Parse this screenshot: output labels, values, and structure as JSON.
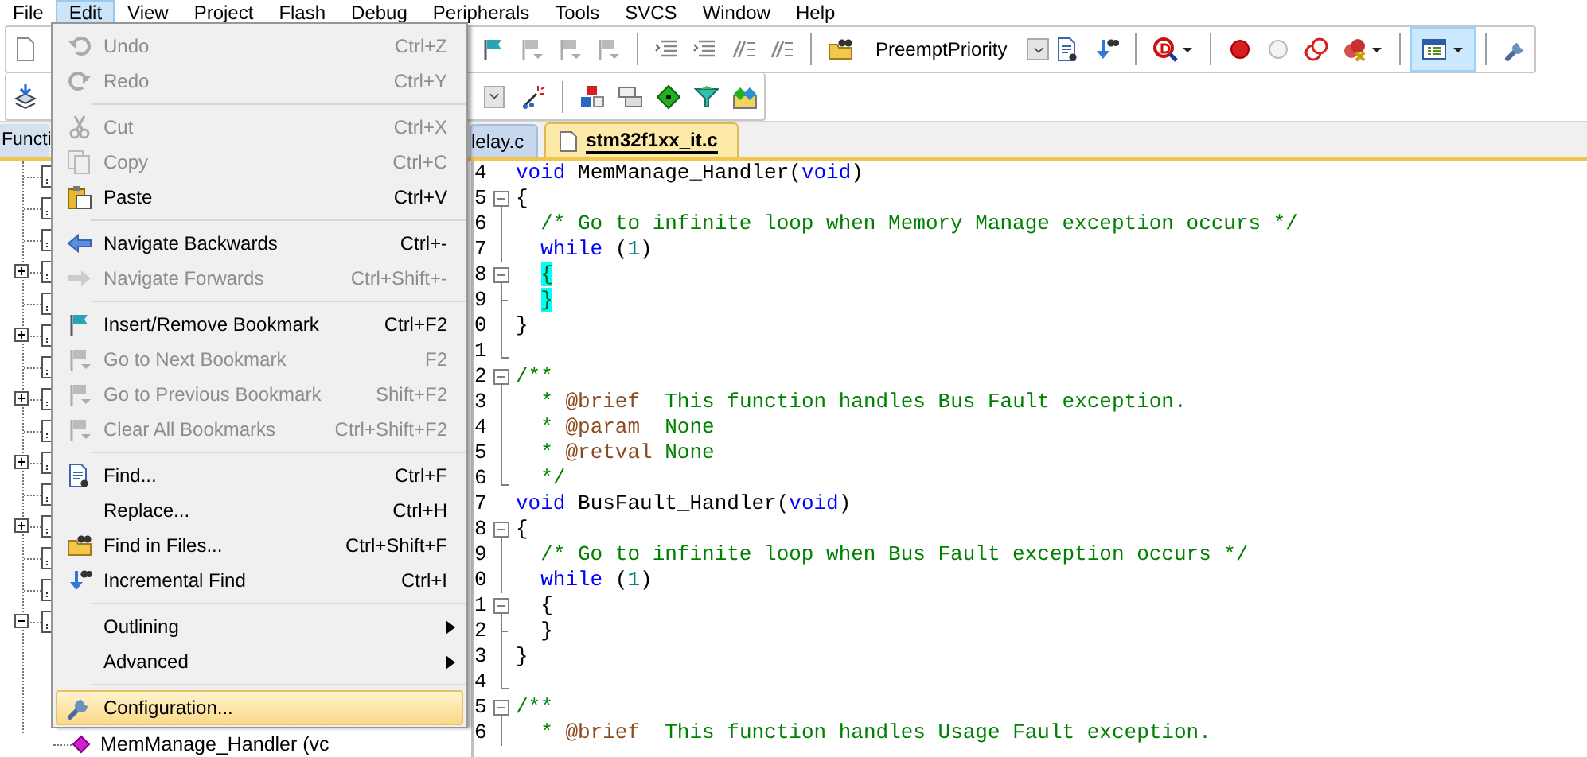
{
  "menu_bar": [
    {
      "label": "File",
      "selected": false
    },
    {
      "label": "Edit",
      "selected": true
    },
    {
      "label": "View",
      "selected": false
    },
    {
      "label": "Project",
      "selected": false
    },
    {
      "label": "Flash",
      "selected": false
    },
    {
      "label": "Debug",
      "selected": false
    },
    {
      "label": "Peripherals",
      "selected": false
    },
    {
      "label": "Tools",
      "selected": false
    },
    {
      "label": "SVCS",
      "selected": false
    },
    {
      "label": "Window",
      "selected": false
    },
    {
      "label": "Help",
      "selected": false
    }
  ],
  "toolbar": {
    "combo": {
      "value": "PreemptPriority"
    },
    "toggle_button": {
      "pressed": true
    }
  },
  "left_panel": {
    "tab": {
      "label": "Functi",
      "selected": true
    },
    "tree": [
      {
        "kind": "leaf"
      },
      {
        "kind": "leaf"
      },
      {
        "kind": "leaf"
      },
      {
        "kind": "group",
        "expanded": false
      },
      {
        "kind": "leaf"
      },
      {
        "kind": "group",
        "expanded": false
      },
      {
        "kind": "leaf"
      },
      {
        "kind": "group",
        "expanded": false
      },
      {
        "kind": "leaf"
      },
      {
        "kind": "group",
        "expanded": false
      },
      {
        "kind": "leaf"
      },
      {
        "kind": "group",
        "expanded": false
      },
      {
        "kind": "leaf"
      },
      {
        "kind": "leaf"
      },
      {
        "kind": "group",
        "expanded": true,
        "children": [
          {
            "label": "MemManage_Handler (vc"
          }
        ]
      }
    ]
  },
  "editor": {
    "tabs": [
      {
        "label": "lelay.c",
        "selected": false
      },
      {
        "label": "stm32f1xx_it.c",
        "selected": true
      }
    ],
    "lines": [
      {
        "number": "4",
        "kind": "none",
        "segments": [
          {
            "kind": "keyword",
            "text": "void"
          },
          {
            "kind": "plain",
            "text": " MemManage_Handler("
          },
          {
            "kind": "keyword",
            "text": "void"
          },
          {
            "kind": "plain",
            "text": ")"
          }
        ]
      },
      {
        "number": "5",
        "kind": "start",
        "segments": [
          {
            "kind": "plain",
            "text": "{"
          }
        ]
      },
      {
        "number": "6",
        "kind": "line",
        "segments": [
          {
            "kind": "comment",
            "text": "  /* Go to infinite loop when Memory Manage exception occurs */"
          }
        ]
      },
      {
        "number": "7",
        "kind": "line",
        "segments": [
          {
            "kind": "keyword",
            "text": "  while"
          },
          {
            "kind": "plain",
            "text": " ("
          },
          {
            "kind": "number",
            "text": "1"
          },
          {
            "kind": "plain",
            "text": ")"
          }
        ]
      },
      {
        "number": "8",
        "kind": "start",
        "segments": [
          {
            "kind": "match",
            "text": "  {"
          }
        ]
      },
      {
        "number": "9",
        "kind": "tick",
        "segments": [
          {
            "kind": "match",
            "text": "  }"
          }
        ]
      },
      {
        "number": "0",
        "kind": "line",
        "segments": [
          {
            "kind": "plain",
            "text": "}"
          }
        ]
      },
      {
        "number": "1",
        "kind": "end"
      },
      {
        "number": "2",
        "kind": "start",
        "segments": [
          {
            "kind": "comment",
            "text": "/**"
          }
        ]
      },
      {
        "number": "3",
        "kind": "line",
        "segments": [
          {
            "kind": "comment",
            "text": "  * "
          },
          {
            "kind": "tag",
            "text": "@brief"
          },
          {
            "kind": "comment",
            "text": "  This function handles Bus Fault exception."
          }
        ]
      },
      {
        "number": "4",
        "kind": "line",
        "segments": [
          {
            "kind": "comment",
            "text": "  * "
          },
          {
            "kind": "tag",
            "text": "@param"
          },
          {
            "kind": "comment",
            "text": "  None"
          }
        ]
      },
      {
        "number": "5",
        "kind": "line",
        "segments": [
          {
            "kind": "comment",
            "text": "  * "
          },
          {
            "kind": "tag",
            "text": "@retval"
          },
          {
            "kind": "comment",
            "text": " None"
          }
        ]
      },
      {
        "number": "6",
        "kind": "end",
        "segments": [
          {
            "kind": "comment",
            "text": "  */"
          }
        ]
      },
      {
        "number": "7",
        "kind": "none",
        "segments": [
          {
            "kind": "keyword",
            "text": "void"
          },
          {
            "kind": "plain",
            "text": " BusFault_Handler("
          },
          {
            "kind": "keyword",
            "text": "void"
          },
          {
            "kind": "plain",
            "text": ")"
          }
        ]
      },
      {
        "number": "8",
        "kind": "start",
        "segments": [
          {
            "kind": "plain",
            "text": "{"
          }
        ]
      },
      {
        "number": "9",
        "kind": "line",
        "segments": [
          {
            "kind": "comment",
            "text": "  /* Go to infinite loop when Bus Fault exception occurs */"
          }
        ]
      },
      {
        "number": "0",
        "kind": "line",
        "segments": [
          {
            "kind": "keyword",
            "text": "  while"
          },
          {
            "kind": "plain",
            "text": " ("
          },
          {
            "kind": "number",
            "text": "1"
          },
          {
            "kind": "plain",
            "text": ")"
          }
        ]
      },
      {
        "number": "1",
        "kind": "start",
        "segments": [
          {
            "kind": "plain",
            "text": "  {"
          }
        ]
      },
      {
        "number": "2",
        "kind": "tick",
        "segments": [
          {
            "kind": "plain",
            "text": "  }"
          }
        ]
      },
      {
        "number": "3",
        "kind": "line",
        "segments": [
          {
            "kind": "plain",
            "text": "}"
          }
        ]
      },
      {
        "number": "4",
        "kind": "end"
      },
      {
        "number": "5",
        "kind": "start",
        "segments": [
          {
            "kind": "comment",
            "text": "/**"
          }
        ]
      },
      {
        "number": "6",
        "kind": "line",
        "segments": [
          {
            "kind": "comment",
            "text": "  * "
          },
          {
            "kind": "tag",
            "text": "@brief"
          },
          {
            "kind": "comment",
            "text": "  This function handles Usage Fault exception."
          }
        ]
      }
    ]
  },
  "edit_menu": {
    "items": [
      {
        "kind": "item",
        "label": "Undo",
        "shortcut": "Ctrl+Z",
        "disabled": true,
        "highlighted": false
      },
      {
        "kind": "item",
        "label": "Redo",
        "shortcut": "Ctrl+Y",
        "disabled": true,
        "highlighted": false
      },
      {
        "kind": "separator"
      },
      {
        "kind": "item",
        "label": "Cut",
        "shortcut": "Ctrl+X",
        "disabled": true,
        "highlighted": false
      },
      {
        "kind": "item",
        "label": "Copy",
        "shortcut": "Ctrl+C",
        "disabled": true,
        "highlighted": false
      },
      {
        "kind": "item",
        "label": "Paste",
        "shortcut": "Ctrl+V",
        "disabled": false,
        "highlighted": false
      },
      {
        "kind": "separator"
      },
      {
        "kind": "item",
        "label": "Navigate Backwards",
        "shortcut": "Ctrl+-",
        "disabled": false,
        "highlighted": false
      },
      {
        "kind": "item",
        "label": "Navigate Forwards",
        "shortcut": "Ctrl+Shift+-",
        "disabled": true,
        "highlighted": false
      },
      {
        "kind": "separator"
      },
      {
        "kind": "item",
        "label": "Insert/Remove Bookmark",
        "shortcut": "Ctrl+F2",
        "disabled": false,
        "highlighted": false
      },
      {
        "kind": "item",
        "label": "Go to Next Bookmark",
        "shortcut": "F2",
        "disabled": true,
        "highlighted": false
      },
      {
        "kind": "item",
        "label": "Go to Previous Bookmark",
        "shortcut": "Shift+F2",
        "disabled": true,
        "highlighted": false
      },
      {
        "kind": "item",
        "label": "Clear All Bookmarks",
        "shortcut": "Ctrl+Shift+F2",
        "disabled": true,
        "highlighted": false
      },
      {
        "kind": "separator"
      },
      {
        "kind": "item",
        "label": "Find...",
        "shortcut": "Ctrl+F",
        "disabled": false,
        "highlighted": false
      },
      {
        "kind": "item",
        "label": "Replace...",
        "shortcut": "Ctrl+H",
        "disabled": false,
        "highlighted": false
      },
      {
        "kind": "item",
        "label": "Find in Files...",
        "shortcut": "Ctrl+Shift+F",
        "disabled": false,
        "highlighted": false
      },
      {
        "kind": "item",
        "label": "Incremental Find",
        "shortcut": "Ctrl+I",
        "disabled": false,
        "highlighted": false
      },
      {
        "kind": "separator"
      },
      {
        "kind": "submenu",
        "label": "Outlining",
        "disabled": false,
        "highlighted": false
      },
      {
        "kind": "submenu",
        "label": "Advanced",
        "disabled": false,
        "highlighted": false
      },
      {
        "kind": "separator"
      },
      {
        "kind": "item",
        "label": "Configuration...",
        "disabled": false,
        "highlighted": true
      }
    ]
  }
}
